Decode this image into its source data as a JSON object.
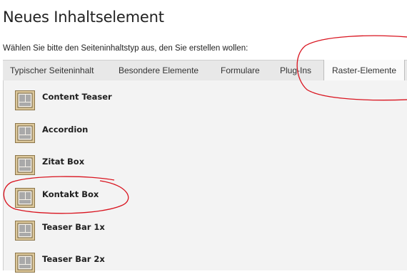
{
  "page": {
    "title": "Neues Inhaltselement",
    "intro": "Wählen Sie bitte den Seiteninhaltstyp aus, den Sie erstellen wollen:"
  },
  "tabs": [
    {
      "label": "Typischer Seiteninhalt",
      "active": false
    },
    {
      "label": "Besondere Elemente",
      "active": false
    },
    {
      "label": "Formulare",
      "active": false
    },
    {
      "label": "Plug-Ins",
      "active": false
    },
    {
      "label": "Raster-Elemente",
      "active": true
    }
  ],
  "items": [
    {
      "label": "Content Teaser",
      "icon": "grid-layout-icon"
    },
    {
      "label": "Accordion",
      "icon": "grid-layout-icon"
    },
    {
      "label": "Zitat Box",
      "icon": "grid-layout-icon"
    },
    {
      "label": "Kontakt Box",
      "icon": "grid-layout-icon"
    },
    {
      "label": "Teaser Bar 1x",
      "icon": "grid-layout-icon"
    },
    {
      "label": "Teaser Bar 2x",
      "icon": "grid-layout-icon"
    }
  ],
  "colors": {
    "annotation": "#d9141f",
    "icon_fill": "#dcc79a",
    "icon_border": "#8a7448",
    "tab_bar": "#e8e8e8",
    "panel": "#f3f3f3"
  }
}
